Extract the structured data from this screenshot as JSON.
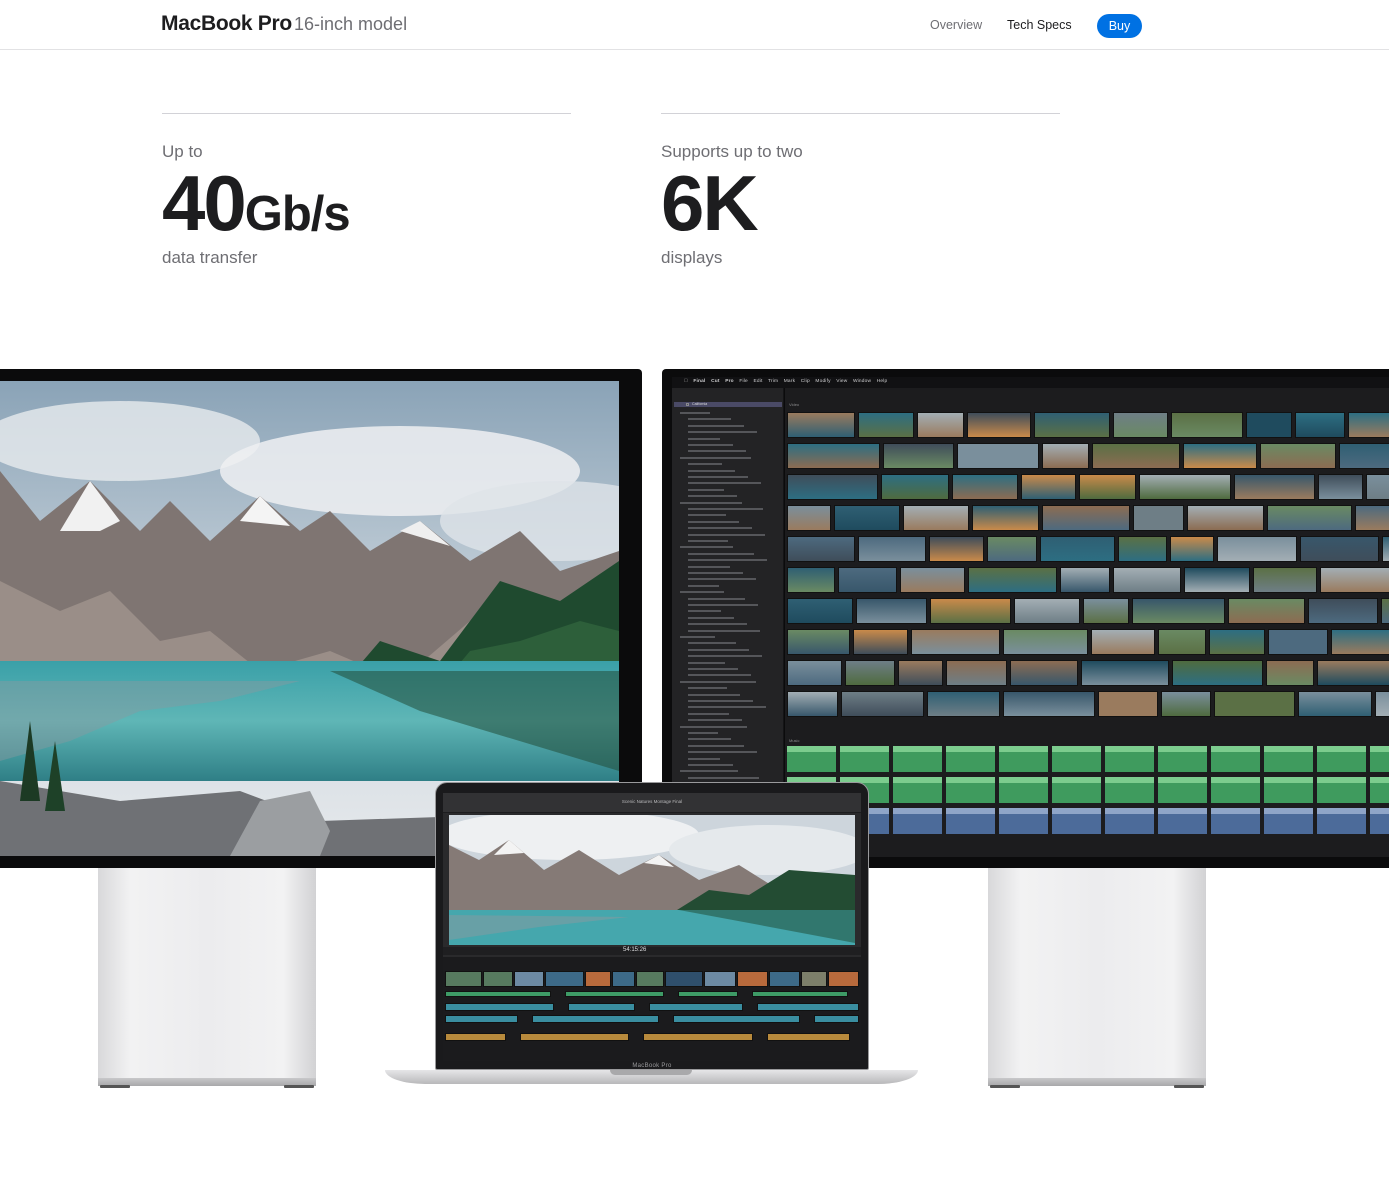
{
  "nav": {
    "title": "MacBook Pro",
    "subtitle": "16-inch model",
    "links": [
      {
        "label": "Overview",
        "current": false
      },
      {
        "label": "Tech Specs",
        "current": true
      }
    ],
    "buy_label": "Buy"
  },
  "stats": [
    {
      "prefix": "Up to",
      "number": "40",
      "unit": "Gb/s",
      "suffix": "data transfer"
    },
    {
      "prefix": "Supports up to two",
      "number": "6K",
      "unit": "",
      "suffix": "displays"
    }
  ],
  "laptop": {
    "label": "MacBook Pro",
    "window_title": "Scenic Natures Montage Final",
    "timecode": "54:15:26"
  },
  "right_display": {
    "menu": [
      "Final Cut Pro",
      "File",
      "Edit",
      "Trim",
      "Mark",
      "Clip",
      "Modify",
      "View",
      "Window",
      "Help"
    ],
    "sidebar_selected": "California",
    "browser_video_label": "Video",
    "browser_music_label": "Music"
  },
  "colors": {
    "accent": "#0071e3",
    "text_primary": "#1d1d1f",
    "text_secondary": "#6e6e73"
  }
}
